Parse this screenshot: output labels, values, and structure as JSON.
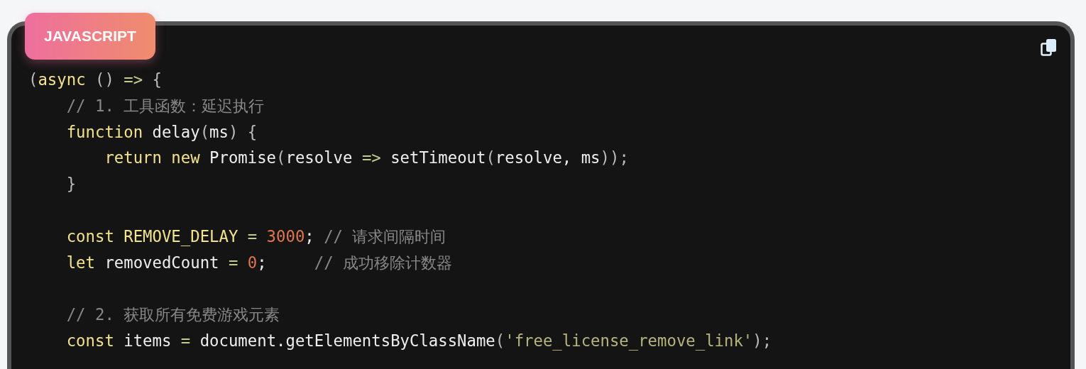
{
  "code_block": {
    "language": "JAVASCRIPT",
    "lines": [
      {
        "kind": "code",
        "tokens": [
          {
            "text": "(",
            "kind": "punct"
          },
          {
            "text": "async",
            "kind": "keyword"
          },
          {
            "text": " () ",
            "kind": "punct"
          },
          {
            "text": "=>",
            "kind": "operator"
          },
          {
            "text": " {",
            "kind": "punct"
          }
        ]
      },
      {
        "kind": "code",
        "tokens": [
          {
            "text": "    // 1. 工具函数：延迟执行",
            "kind": "comment"
          }
        ]
      },
      {
        "kind": "code",
        "tokens": [
          {
            "text": "    function",
            "kind": "keyword"
          },
          {
            "text": " delay",
            "kind": "plain"
          },
          {
            "text": "(",
            "kind": "punct"
          },
          {
            "text": "ms",
            "kind": "plain"
          },
          {
            "text": ") {",
            "kind": "punct"
          }
        ]
      },
      {
        "kind": "code",
        "tokens": [
          {
            "text": "        return new",
            "kind": "keyword"
          },
          {
            "text": " Promise",
            "kind": "plain"
          },
          {
            "text": "(",
            "kind": "punct"
          },
          {
            "text": "resolve ",
            "kind": "plain"
          },
          {
            "text": "=>",
            "kind": "operator"
          },
          {
            "text": " setTimeout",
            "kind": "plain"
          },
          {
            "text": "(",
            "kind": "punct"
          },
          {
            "text": "resolve, ms",
            "kind": "plain"
          },
          {
            "text": "));",
            "kind": "punct"
          }
        ]
      },
      {
        "kind": "code",
        "tokens": [
          {
            "text": "    }",
            "kind": "punct"
          }
        ]
      },
      {
        "kind": "blank"
      },
      {
        "kind": "code",
        "tokens": [
          {
            "text": "    const REMOVE_DELAY",
            "kind": "keyword"
          },
          {
            "text": " = ",
            "kind": "operator"
          },
          {
            "text": "3000",
            "kind": "number"
          },
          {
            "text": "; ",
            "kind": "plain"
          },
          {
            "text": "// 请求间隔时间",
            "kind": "comment"
          }
        ]
      },
      {
        "kind": "code",
        "tokens": [
          {
            "text": "    let",
            "kind": "keyword"
          },
          {
            "text": " removedCount ",
            "kind": "plain"
          },
          {
            "text": "=",
            "kind": "operator"
          },
          {
            "text": " 0",
            "kind": "number"
          },
          {
            "text": ";     ",
            "kind": "plain"
          },
          {
            "text": "// 成功移除计数器",
            "kind": "comment"
          }
        ]
      },
      {
        "kind": "blank"
      },
      {
        "kind": "code",
        "tokens": [
          {
            "text": "    // 2. 获取所有免费游戏元素",
            "kind": "comment"
          }
        ]
      },
      {
        "kind": "code",
        "tokens": [
          {
            "text": "    const",
            "kind": "keyword"
          },
          {
            "text": " items ",
            "kind": "plain"
          },
          {
            "text": "=",
            "kind": "operator"
          },
          {
            "text": " document.getElementsByClassName",
            "kind": "plain"
          },
          {
            "text": "(",
            "kind": "punct"
          },
          {
            "text": "'free_license_remove_link'",
            "kind": "string"
          },
          {
            "text": ");",
            "kind": "punct"
          }
        ]
      }
    ]
  }
}
